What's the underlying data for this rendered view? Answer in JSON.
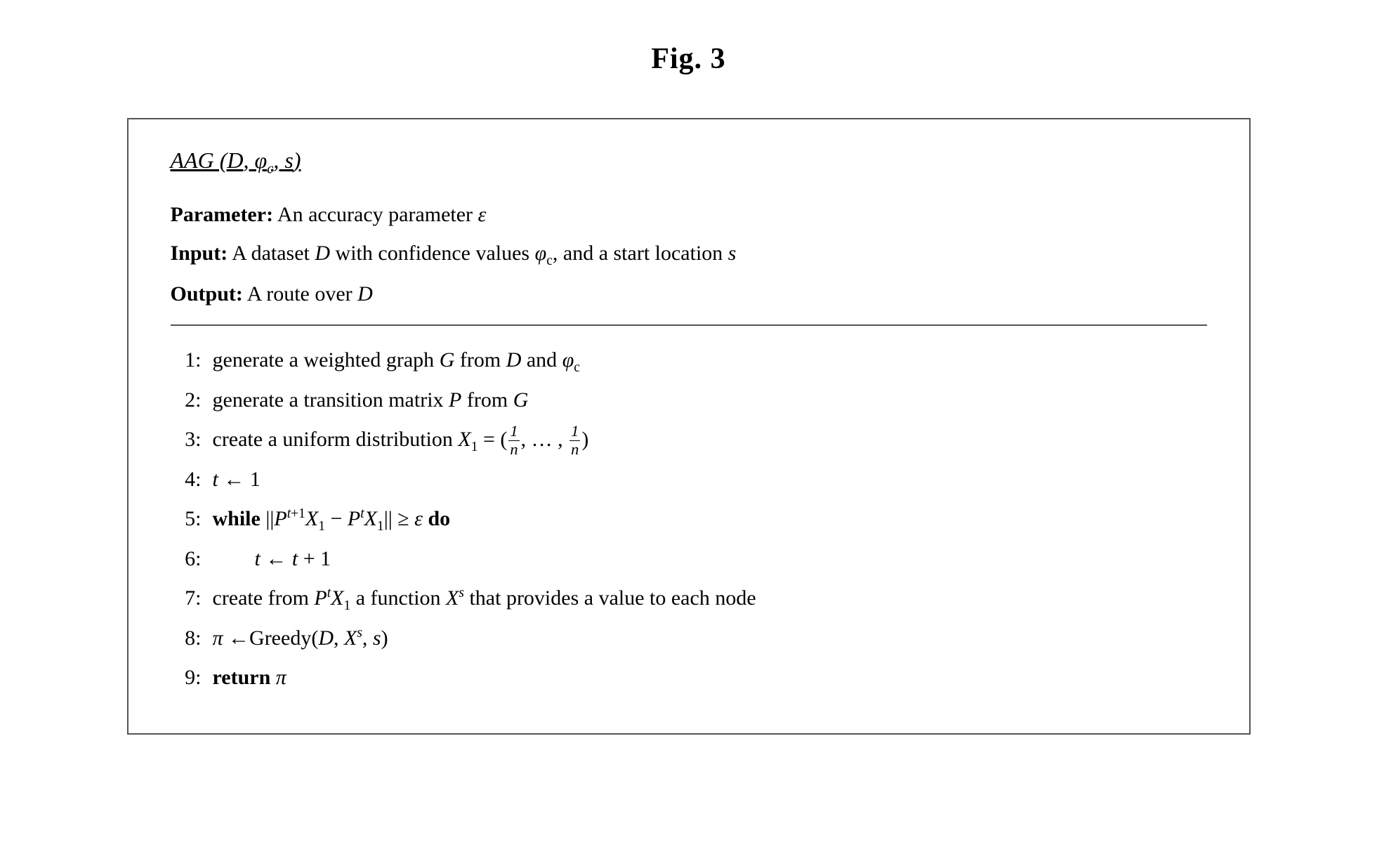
{
  "page": {
    "title": "Fig. 3",
    "algorithm": {
      "header": "AAG (D, φ_c, s)",
      "parameter_label": "Parameter:",
      "parameter_text": "An accuracy parameter ε",
      "input_label": "Input:",
      "input_text": "A dataset D with confidence values φ_c, and a start location s",
      "output_label": "Output:",
      "output_text": "A route over D",
      "steps": [
        {
          "num": "1:",
          "text": "generate a weighted graph G from D and φ_c"
        },
        {
          "num": "2:",
          "text": "generate a transition matrix P from G"
        },
        {
          "num": "3:",
          "text": "create a uniform distribution X_1 = (1/n, ..., 1/n)"
        },
        {
          "num": "4:",
          "text": "t ← 1"
        },
        {
          "num": "5:",
          "text": "while ||P^{t+1}X_1 − P^t X_1|| ≥ ε do"
        },
        {
          "num": "6:",
          "text": "t ← t + 1",
          "indent": true
        },
        {
          "num": "7:",
          "text": "create from P^t X_1 a function X^s that provides a value to each node"
        },
        {
          "num": "8:",
          "text": "π ←Greedy(D, X^s, s)"
        },
        {
          "num": "9:",
          "text": "return π"
        }
      ]
    }
  }
}
